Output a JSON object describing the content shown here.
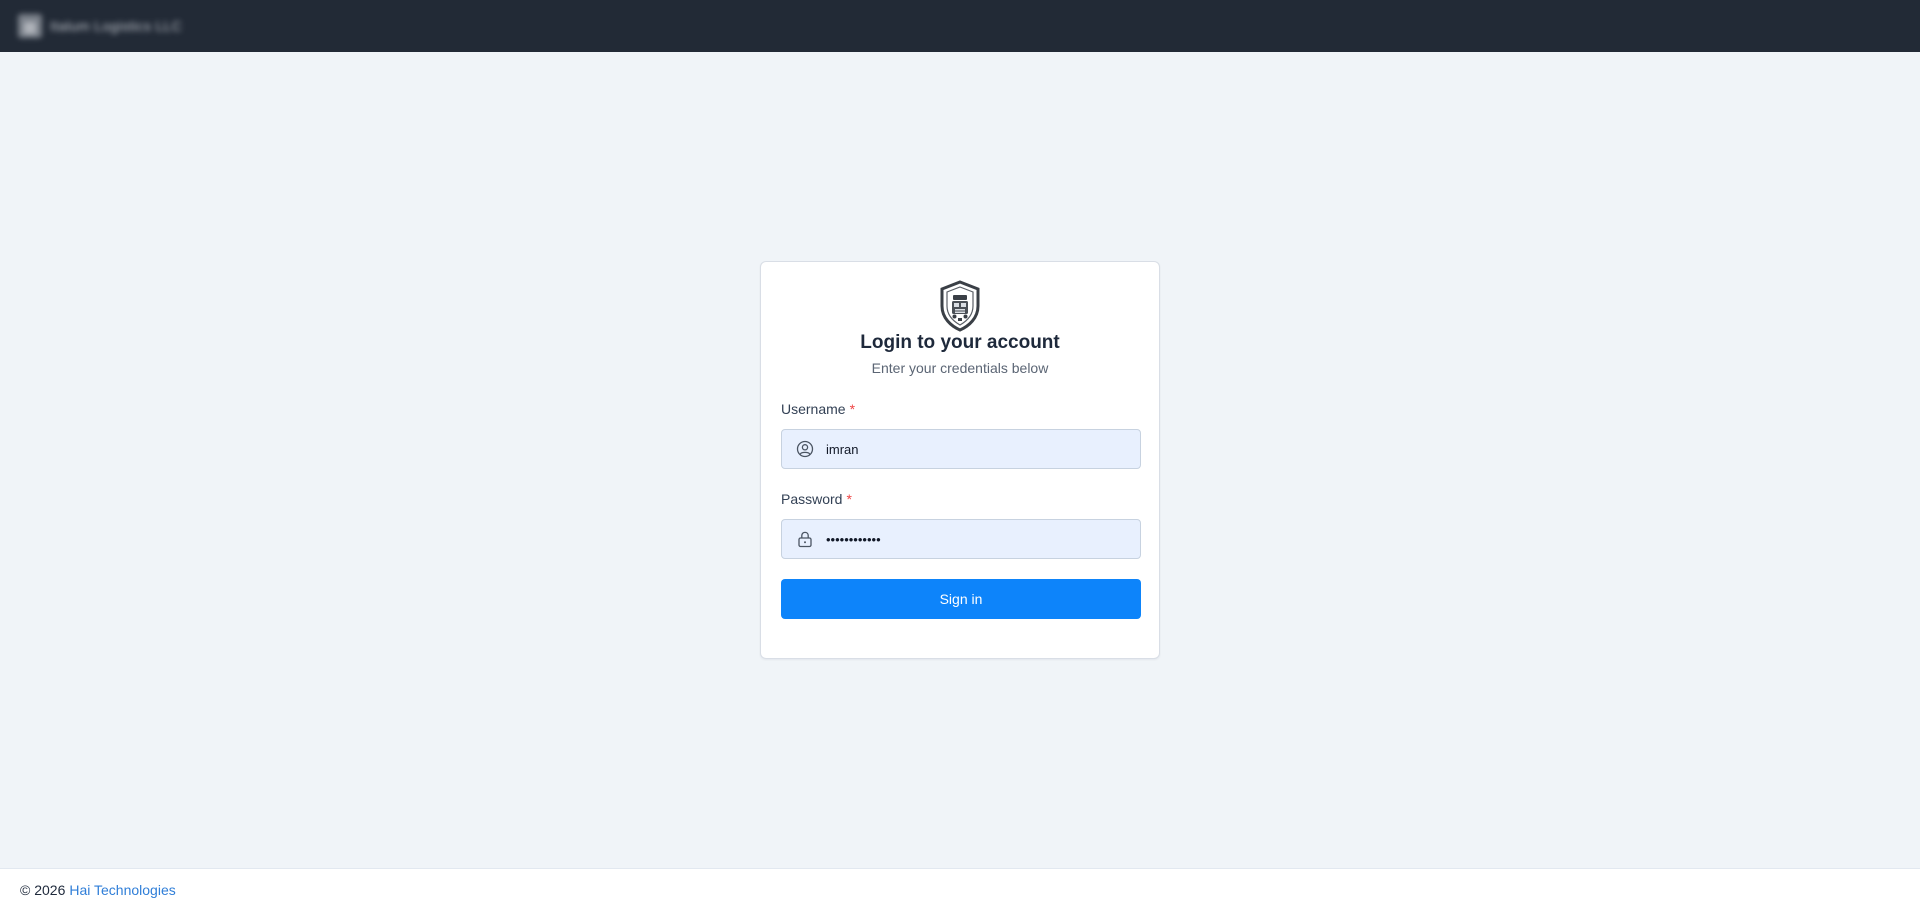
{
  "header": {
    "brand_name": "Italum Logistics LLC"
  },
  "login": {
    "title": "Login to your account",
    "subtitle": "Enter your credentials below",
    "username": {
      "label": "Username",
      "required_mark": "*",
      "value": "imran",
      "icon": "user-circle-icon"
    },
    "password": {
      "label": "Password",
      "required_mark": "*",
      "value": "••••••••••••",
      "icon": "lock-icon"
    },
    "submit_label": "Sign in"
  },
  "footer": {
    "copyright": "© 2026",
    "company_link": "Hai Technologies"
  },
  "colors": {
    "topbar": "#222a36",
    "background": "#f0f4f8",
    "primary": "#0d84fa",
    "input_fill": "#e8f0fe",
    "required": "#ef4444",
    "link": "#2f7ed8"
  }
}
